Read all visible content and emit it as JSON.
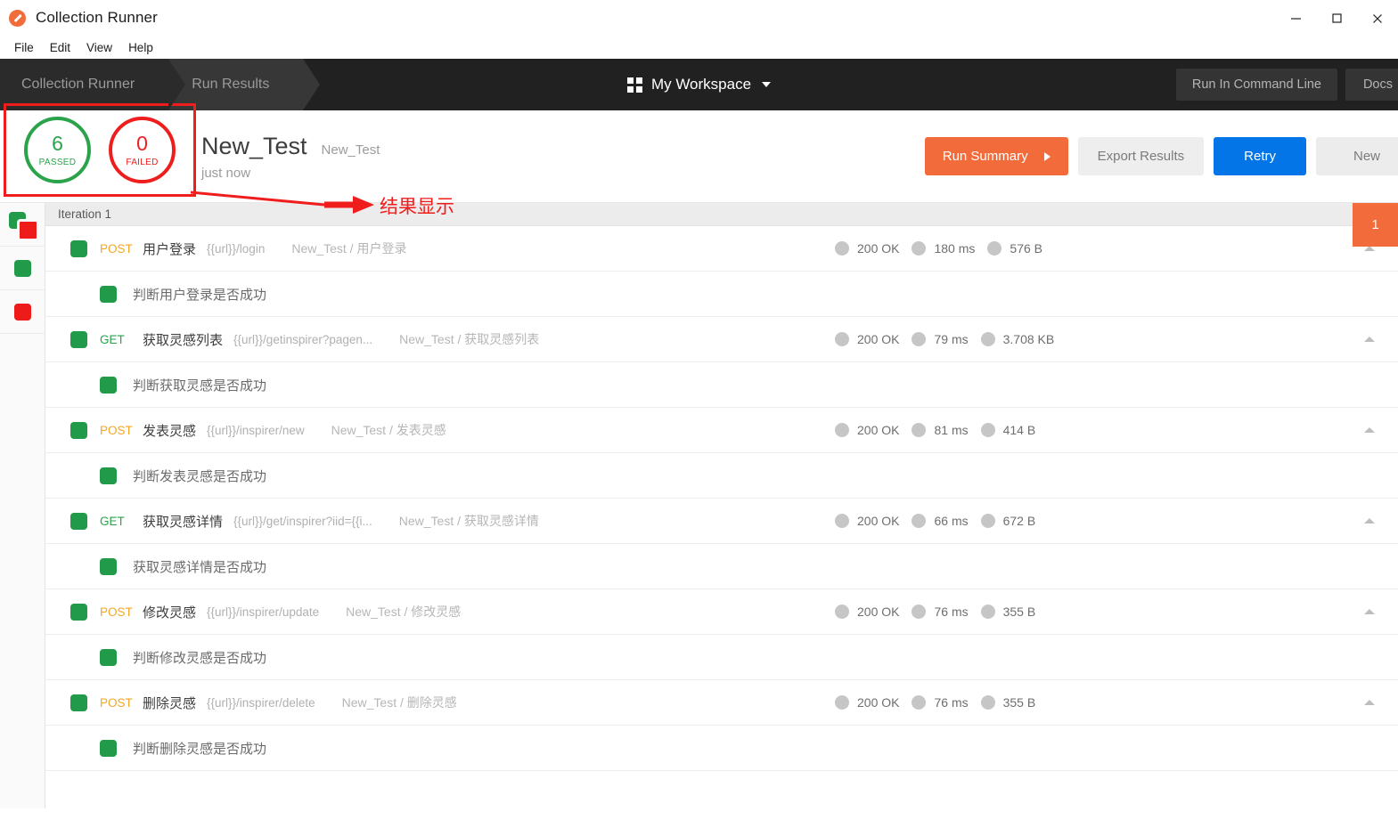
{
  "window": {
    "title": "Collection Runner",
    "logo_icon": "postman-logo-icon",
    "minimize_icon": "minimize-icon",
    "maximize_icon": "maximize-icon",
    "close_icon": "close-icon"
  },
  "menubar": {
    "items": [
      "File",
      "Edit",
      "View",
      "Help"
    ]
  },
  "header": {
    "crumbs": [
      "Collection Runner",
      "Run Results"
    ],
    "workspace": {
      "icon": "grid-icon",
      "name": "My Workspace",
      "caret_icon": "chevron-down-icon"
    },
    "buttons": [
      "Run In Command Line",
      "Docs"
    ]
  },
  "summary": {
    "passed": {
      "count": "6",
      "label": "PASSED"
    },
    "failed": {
      "count": "0",
      "label": "FAILED"
    },
    "run_title": "New_Test",
    "collection_name": "New_Test",
    "run_time": "just now",
    "annotation": "结果显示",
    "actions": {
      "run_summary": "Run Summary",
      "export_results": "Export Results",
      "retry": "Retry",
      "new": "New"
    }
  },
  "filter_rail": {
    "items": [
      "all-filter",
      "passed-filter",
      "failed-filter"
    ]
  },
  "results": {
    "iteration_label": "Iteration 1",
    "iteration_badge": "1",
    "rows": [
      {
        "status": "pass",
        "method": "POST",
        "name": "用户登录",
        "url": "{{url}}/login",
        "path": "New_Test / 用户登录",
        "code": "200 OK",
        "time": "180 ms",
        "size": "576 B",
        "test": "判断用户登录是否成功"
      },
      {
        "status": "pass",
        "method": "GET",
        "name": "获取灵感列表",
        "url": "{{url}}/getinspirer?pagen...",
        "path": "New_Test / 获取灵感列表",
        "code": "200 OK",
        "time": "79 ms",
        "size": "3.708 KB",
        "test": "判断获取灵感是否成功"
      },
      {
        "status": "pass",
        "method": "POST",
        "name": "发表灵感",
        "url": "{{url}}/inspirer/new",
        "path": "New_Test / 发表灵感",
        "code": "200 OK",
        "time": "81 ms",
        "size": "414 B",
        "test": "判断发表灵感是否成功"
      },
      {
        "status": "pass",
        "method": "GET",
        "name": "获取灵感详情",
        "url": "{{url}}/get/inspirer?iid={{i...",
        "path": "New_Test / 获取灵感详情",
        "code": "200 OK",
        "time": "66 ms",
        "size": "672 B",
        "test": "获取灵感详情是否成功"
      },
      {
        "status": "pass",
        "method": "POST",
        "name": "修改灵感",
        "url": "{{url}}/inspirer/update",
        "path": "New_Test / 修改灵感",
        "code": "200 OK",
        "time": "76 ms",
        "size": "355 B",
        "test": "判断修改灵感是否成功"
      },
      {
        "status": "pass",
        "method": "POST",
        "name": "删除灵感",
        "url": "{{url}}/inspirer/delete",
        "path": "New_Test / 删除灵感",
        "code": "200 OK",
        "time": "76 ms",
        "size": "355 B",
        "test": "判断删除灵感是否成功"
      }
    ]
  },
  "colors": {
    "accent_orange": "#f26b3a",
    "pass_green": "#219a4a",
    "fail_red": "#ee1b1b",
    "retry_blue": "#0375e6",
    "method_post": "#f5a623",
    "method_get": "#2aa34a",
    "annotation_red": "#f01d1d"
  }
}
